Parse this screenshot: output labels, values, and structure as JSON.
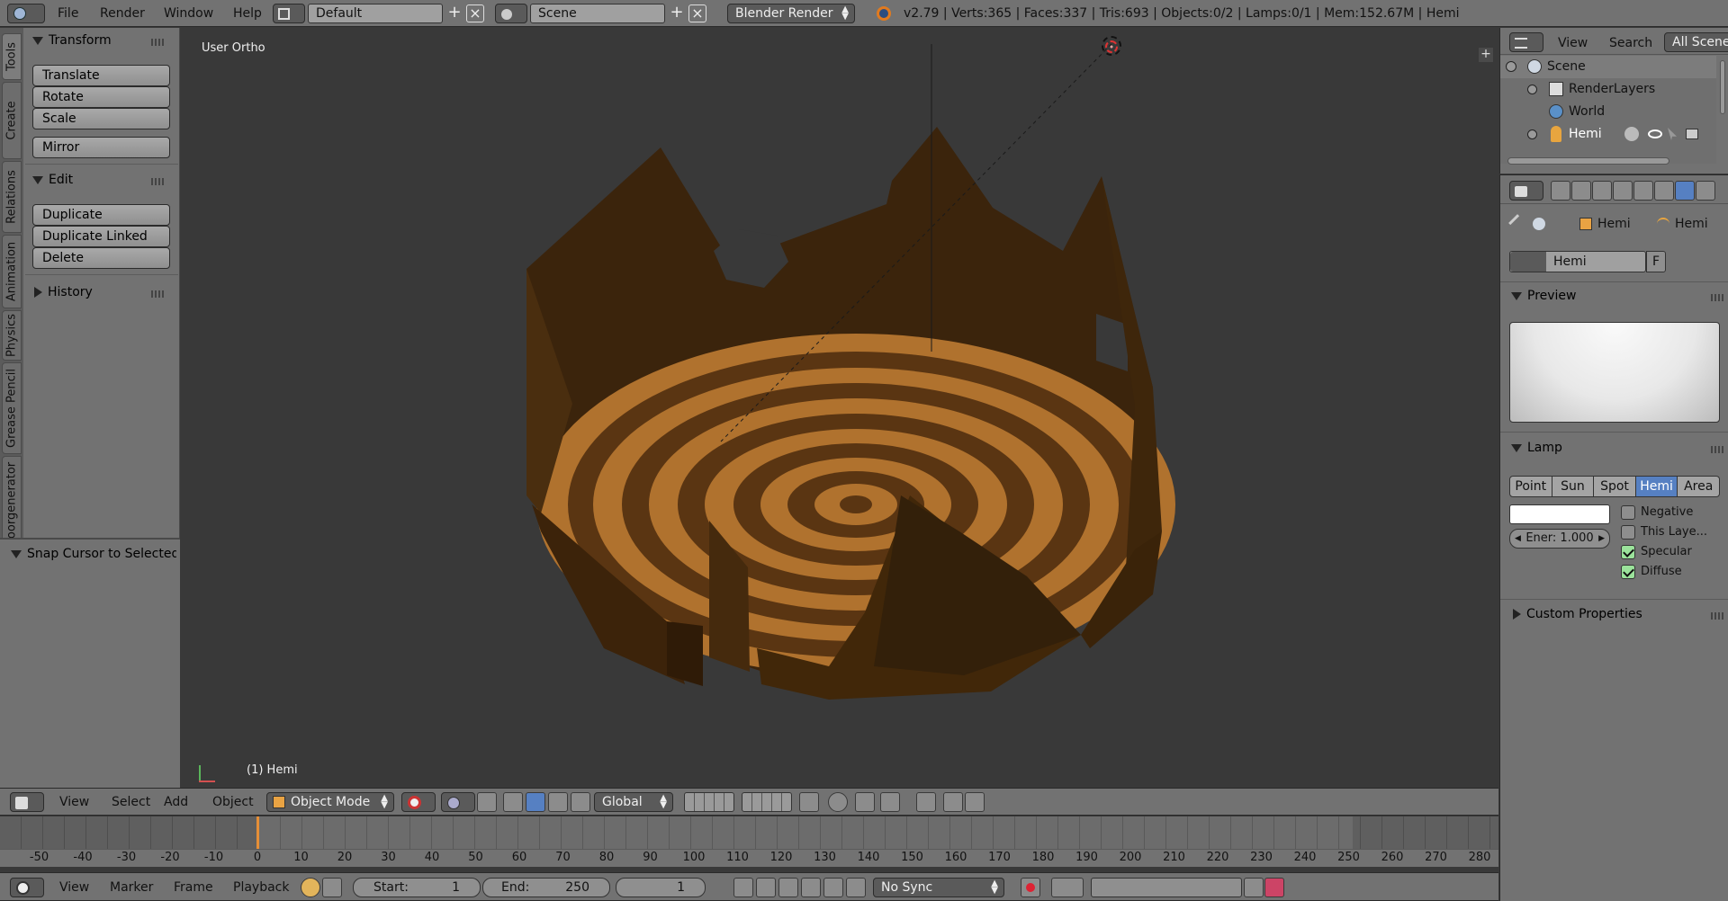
{
  "topbar": {
    "menus": [
      "File",
      "Render",
      "Window",
      "Help"
    ],
    "screen_layout": "Default",
    "scene": "Scene",
    "render_engine": "Blender Render",
    "stats": "v2.79 | Verts:365 | Faces:337 | Tris:693 | Objects:0/2 | Lamps:0/1 | Mem:152.67M | Hemi"
  },
  "tool_shelf": {
    "tabs": [
      "Tools",
      "Create",
      "Relations",
      "Animation",
      "Physics",
      "Grease Pencil",
      "Floorgenerator"
    ],
    "transform": {
      "title": "Transform",
      "buttons": [
        "Translate",
        "Rotate",
        "Scale",
        "Mirror"
      ]
    },
    "edit": {
      "title": "Edit",
      "buttons": [
        "Duplicate",
        "Duplicate Linked",
        "Delete"
      ]
    },
    "history": {
      "title": "History"
    },
    "operator": {
      "title": "Snap Cursor to Selected"
    }
  },
  "viewport": {
    "view_label": "User Ortho",
    "object_label": "(1) Hemi",
    "colors": {
      "background": "#393939",
      "wood_light": "#b0722e",
      "wood_dark": "#5a3512",
      "wall": "#3b240c"
    }
  },
  "view3d_header": {
    "menus": [
      "View",
      "Select",
      "Add",
      "Object"
    ],
    "mode": "Object Mode",
    "orientation": "Global"
  },
  "timeline": {
    "ticks": [
      "-50",
      "-40",
      "-30",
      "-20",
      "-10",
      "0",
      "10",
      "20",
      "30",
      "40",
      "50",
      "60",
      "70",
      "80",
      "90",
      "100",
      "110",
      "120",
      "130",
      "140",
      "150",
      "160",
      "170",
      "180",
      "190",
      "200",
      "210",
      "220",
      "230",
      "240",
      "250",
      "260",
      "270",
      "280"
    ],
    "current_frame_marker": 0
  },
  "timeline_header": {
    "menus": [
      "View",
      "Marker",
      "Frame",
      "Playback"
    ],
    "start_label": "Start:",
    "start_value": "1",
    "end_label": "End:",
    "end_value": "250",
    "current_frame": "1",
    "sync": "No Sync"
  },
  "outliner": {
    "header": {
      "view": "View",
      "search": "Search",
      "scenes": "All Scenes"
    },
    "items": [
      "Scene",
      "RenderLayers",
      "World",
      "Hemi"
    ]
  },
  "properties": {
    "breadcrumb": [
      "Hemi",
      "Hemi"
    ],
    "datablock_name": "Hemi",
    "fake_user": "F",
    "preview_title": "Preview",
    "lamp_title": "Lamp",
    "lamp_types": [
      "Point",
      "Sun",
      "Spot",
      "Hemi",
      "Area"
    ],
    "active_lamp_type": "Hemi",
    "energy": "Ener: 1.000",
    "options": [
      {
        "label": "Negative",
        "checked": false
      },
      {
        "label": "This Laye...",
        "checked": false
      },
      {
        "label": "Specular",
        "checked": true
      },
      {
        "label": "Diffuse",
        "checked": true
      }
    ],
    "custom_props_title": "Custom Properties",
    "accent": "#5680c2"
  }
}
